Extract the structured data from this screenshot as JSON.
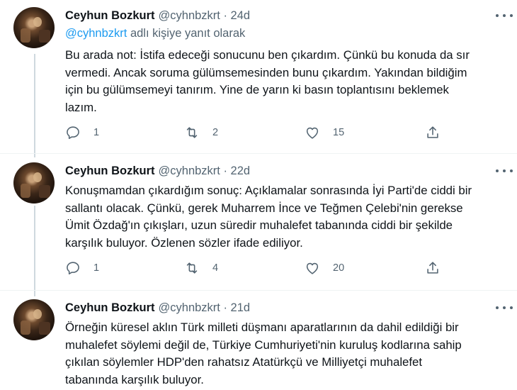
{
  "tweets": [
    {
      "name": "Ceyhun Bozkurt",
      "meta": "@cyhnbzkrt · 24d",
      "reply_mention": "@cyhnbzkrt",
      "reply_suffix": " adlı kişiye yanıt olarak",
      "lines": [
        "Bu arada not: İstifa edeceği sonucunu ben çıkardım. Çünkü bu konuda da sır",
        "vermedi. Ancak soruma gülümsemesinden bunu çıkardım. Yakından bildiğim",
        "için bu gülümsemeyi tanırım. Yine de yarın ki basın toplantısını beklemek",
        "lazım."
      ],
      "replies": "1",
      "retweets": "2",
      "likes": "15"
    },
    {
      "name": "Ceyhun Bozkurt",
      "meta": "@cyhnbzkrt · 22d",
      "lines": [
        "Konuşmamdan çıkardığım sonuç: Açıklamalar sonrasında İyi Parti'de ciddi bir",
        "sallantı olacak. Çünkü, gerek Muharrem İnce ve Teğmen Çelebi'nin gerekse",
        "Ümit Özdağ'ın çıkışları, uzun süredir muhalefet tabanında ciddi bir şekilde",
        "karşılık buluyor. Özlenen sözler ifade ediliyor."
      ],
      "replies": "1",
      "retweets": "4",
      "likes": "20"
    },
    {
      "name": "Ceyhun Bozkurt",
      "meta": "@cyhnbzkrt · 21d",
      "lines": [
        "Örneğin küresel aklın Türk milleti düşmanı aparatlarının da dahil edildiği bir",
        "muhalefet söylemi değil de, Türkiye Cumhuriyeti'nin kuruluş kodlarına sahip",
        "çıkılan söylemler HDP'den rahatsız Atatürkçü ve Milliyetçi muhalefet",
        "tabanında karşılık buluyor."
      ]
    }
  ],
  "icons": {
    "reply": "reply-icon",
    "retweet": "retweet-icon",
    "like": "heart-icon",
    "share": "share-icon",
    "more": "more-icon"
  },
  "colors": {
    "accent": "#1d9bf0",
    "secondary_text": "#536471",
    "thread_line": "#cfd9de"
  }
}
